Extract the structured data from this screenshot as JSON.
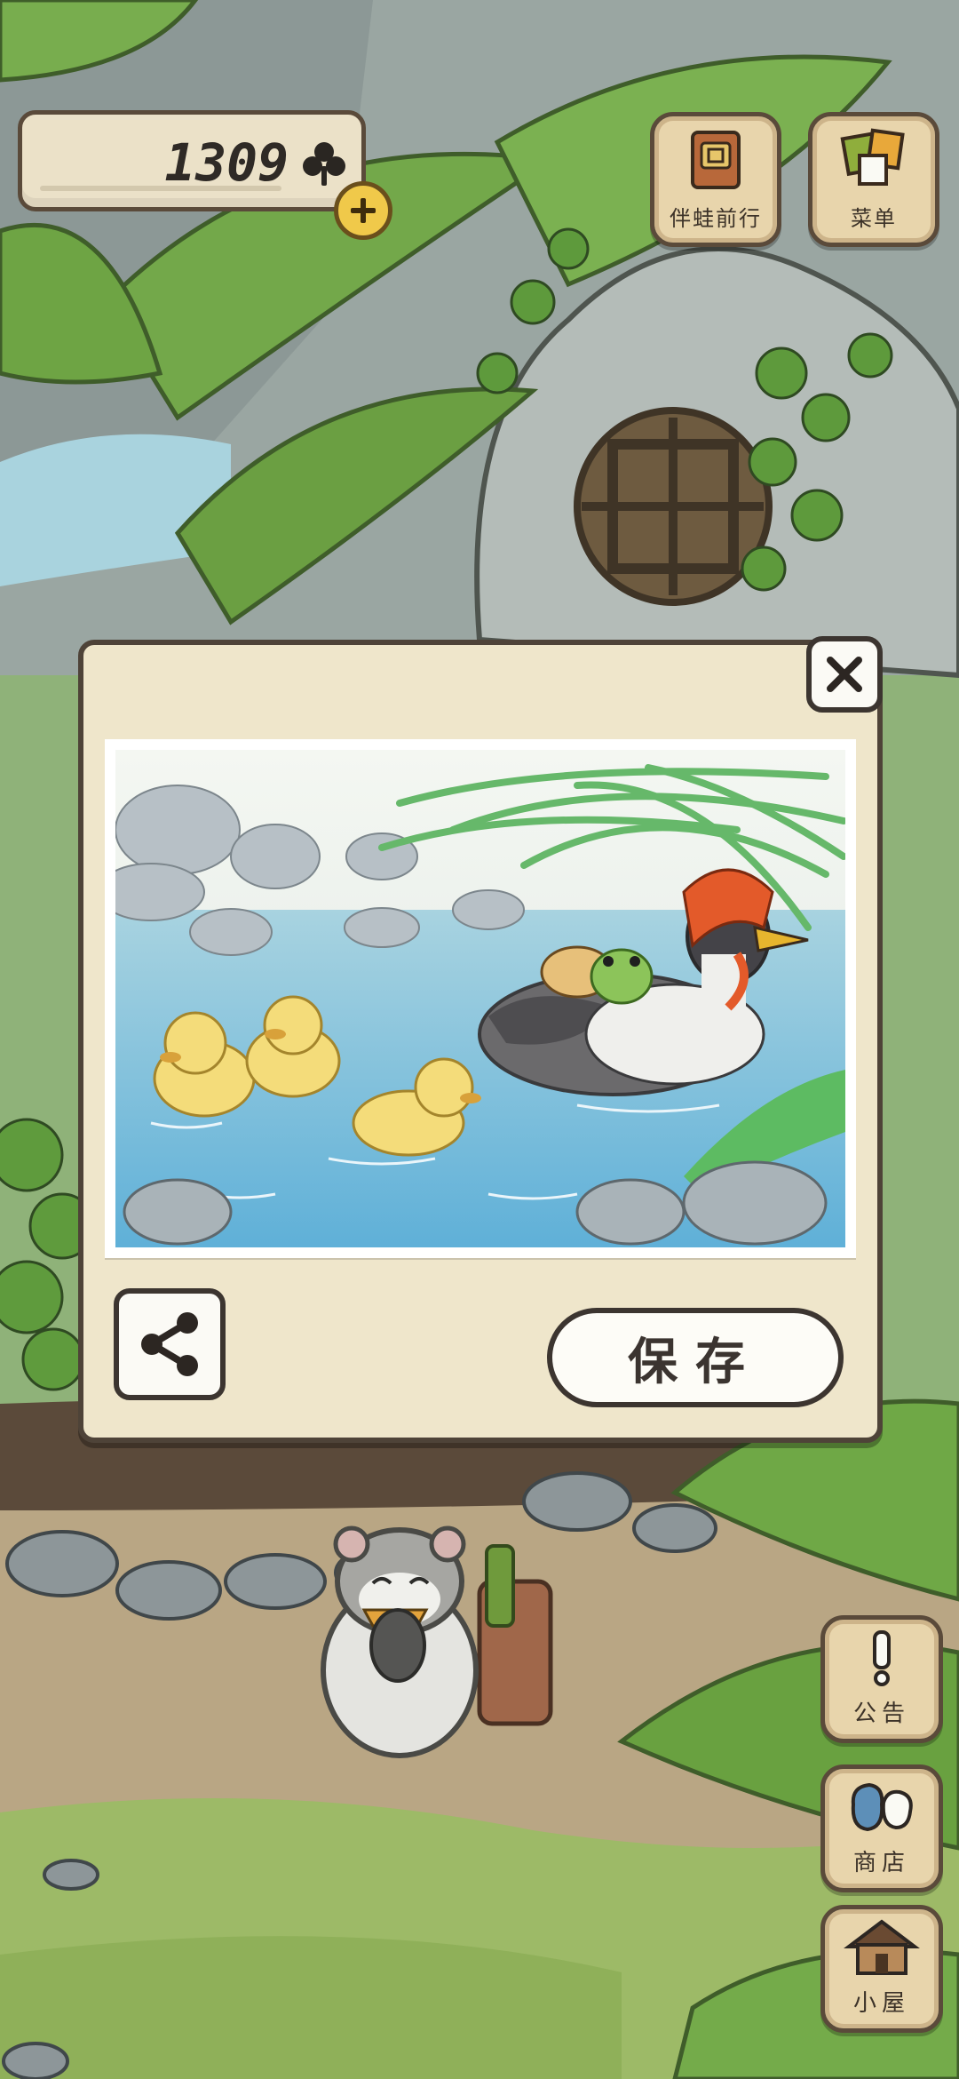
{
  "currency": {
    "amount": "1309",
    "icon": "clover-icon"
  },
  "top_buttons": [
    {
      "label": "伴蛙前行",
      "icon": "notebook-icon"
    },
    {
      "label": "菜单",
      "icon": "cards-icon"
    }
  ],
  "photo_dialog": {
    "close_icon": "close-icon",
    "share_icon": "share-icon",
    "save_label": "保存"
  },
  "side_buttons": [
    {
      "label": "公告",
      "icon": "exclamation-icon"
    },
    {
      "label": "商店",
      "icon": "bags-icon"
    },
    {
      "label": "小屋",
      "icon": "house-icon"
    }
  ],
  "colors": {
    "panel": "#efe6cb",
    "outline": "#3c3530",
    "button_wood": "#e8d5ac",
    "leaf_green": "#6fa846",
    "water": "#7ec4de"
  }
}
